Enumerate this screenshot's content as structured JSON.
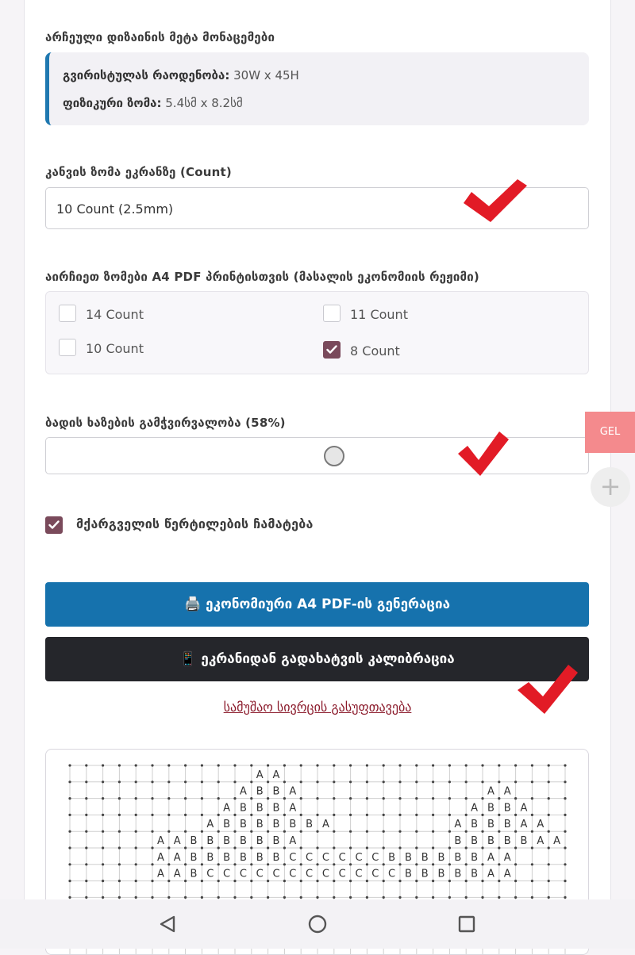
{
  "meta": {
    "title": "არჩეული დიზაინის მეტა მონაცემები",
    "stitch_count_label": "გვირისტულას რაოდენობა:",
    "stitch_count_value": "30W x 45H",
    "physical_size_label": "ფიზიკური ზომა:",
    "physical_size_value": "5.4სმ x 8.2სმ"
  },
  "canvas_select": {
    "label": "კანვის ზომა ეკრანზე (Count)",
    "value": "10 Count (2.5mm)"
  },
  "print_sizes": {
    "label": "აირჩიეთ ზომები A4 PDF პრინტისთვის (მასალის ეკონომიის რეჟიმი)",
    "options": [
      {
        "label": "14 Count",
        "checked": false
      },
      {
        "label": "11 Count",
        "checked": false
      },
      {
        "label": "10 Count",
        "checked": false
      },
      {
        "label": "8 Count",
        "checked": true
      }
    ]
  },
  "grid_opacity": {
    "label": "ბადის ხაზების გამჭვირვალობა (58%)",
    "value": 0.58
  },
  "center_dots": {
    "label": "მქარგველის წერტილების ჩამატება",
    "checked": true
  },
  "buttons": {
    "pdf_icon": "🖨️",
    "pdf_label": "ეკონომიური A4 PDF-ის გენერაცია",
    "calibrate_icon": "📱",
    "calibrate_label": "ეკრანიდან გადახატვის კალიბრაცია"
  },
  "clear_link": "სამუშაო სივრცის გასუფთავება",
  "side_tag": "GEL",
  "side_plus": "+",
  "pattern_rows": [
    "...........AA.....................",
    "..........ABBA...........AA.......",
    ".........ABBBA..........ABBA......",
    "........ABBBBBBA.......ABBBAA.....",
    ".....AABBBBBBA.........BBBBBAA....",
    ".....AABBBBBBCCCCCCBBBBBBAA.......",
    ".....AABCCCCCCCCCCCCBBBBBAA......."
  ],
  "accent_colors": {
    "primary": "#1672ad",
    "dark": "#25262b",
    "checkbox": "#7a4a5b",
    "link": "#8b1a2b",
    "annotation": "#e21b26"
  }
}
